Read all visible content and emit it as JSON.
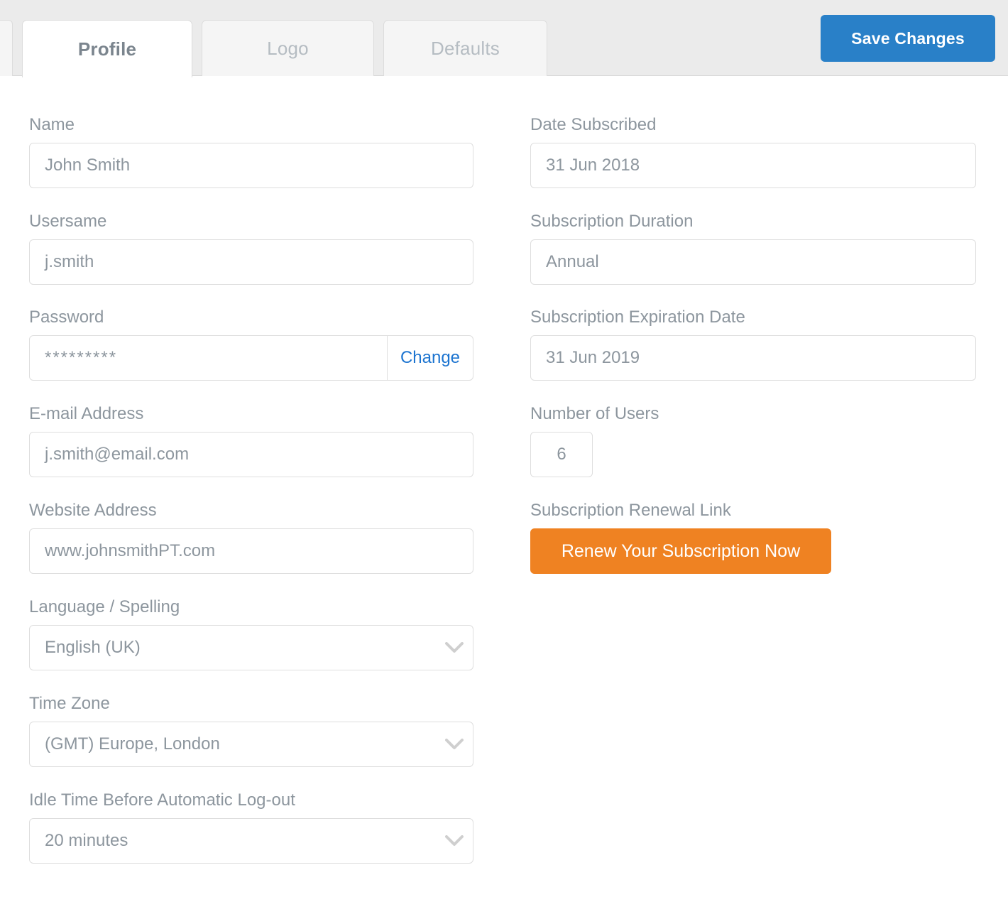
{
  "tabs": [
    {
      "id": "profile",
      "label": "Profile",
      "active": true
    },
    {
      "id": "logo",
      "label": "Logo",
      "active": false
    },
    {
      "id": "defaults",
      "label": "Defaults",
      "active": false
    }
  ],
  "toolbar": {
    "save_label": "Save Changes",
    "save_color": "#2980c8"
  },
  "left_column": {
    "name": {
      "label": "Name",
      "value": "John Smith"
    },
    "username": {
      "label": "Usersame",
      "value": "j.smith"
    },
    "password": {
      "label": "Password",
      "value": "*********",
      "action_label": "Change",
      "action_color": "#1c74d0"
    },
    "email": {
      "label": "E-mail Address",
      "value": "j.smith@email.com"
    },
    "website": {
      "label": "Website Address",
      "value": "www.johnsmithPT.com"
    },
    "language": {
      "label": "Language / Spelling",
      "value": "English (UK)",
      "icon": "chevron-down-icon"
    },
    "timezone": {
      "label": "Time Zone",
      "value": "(GMT) Europe, London",
      "icon": "chevron-down-icon"
    },
    "idle_time": {
      "label": "Idle Time Before Automatic Log-out",
      "value": "20 minutes",
      "icon": "chevron-down-icon"
    }
  },
  "right_column": {
    "date_subscribed": {
      "label": "Date Subscribed",
      "value": "31 Jun 2018"
    },
    "subscription_duration": {
      "label": "Subscription Duration",
      "value": "Annual"
    },
    "expiration_date": {
      "label": "Subscription Expiration Date",
      "value": "31 Jun 2019"
    },
    "number_of_users": {
      "label": "Number of Users",
      "value": "6"
    },
    "renewal": {
      "label": "Subscription Renewal Link",
      "button_label": "Renew Your Subscription Now",
      "button_color": "#ef8222"
    }
  }
}
